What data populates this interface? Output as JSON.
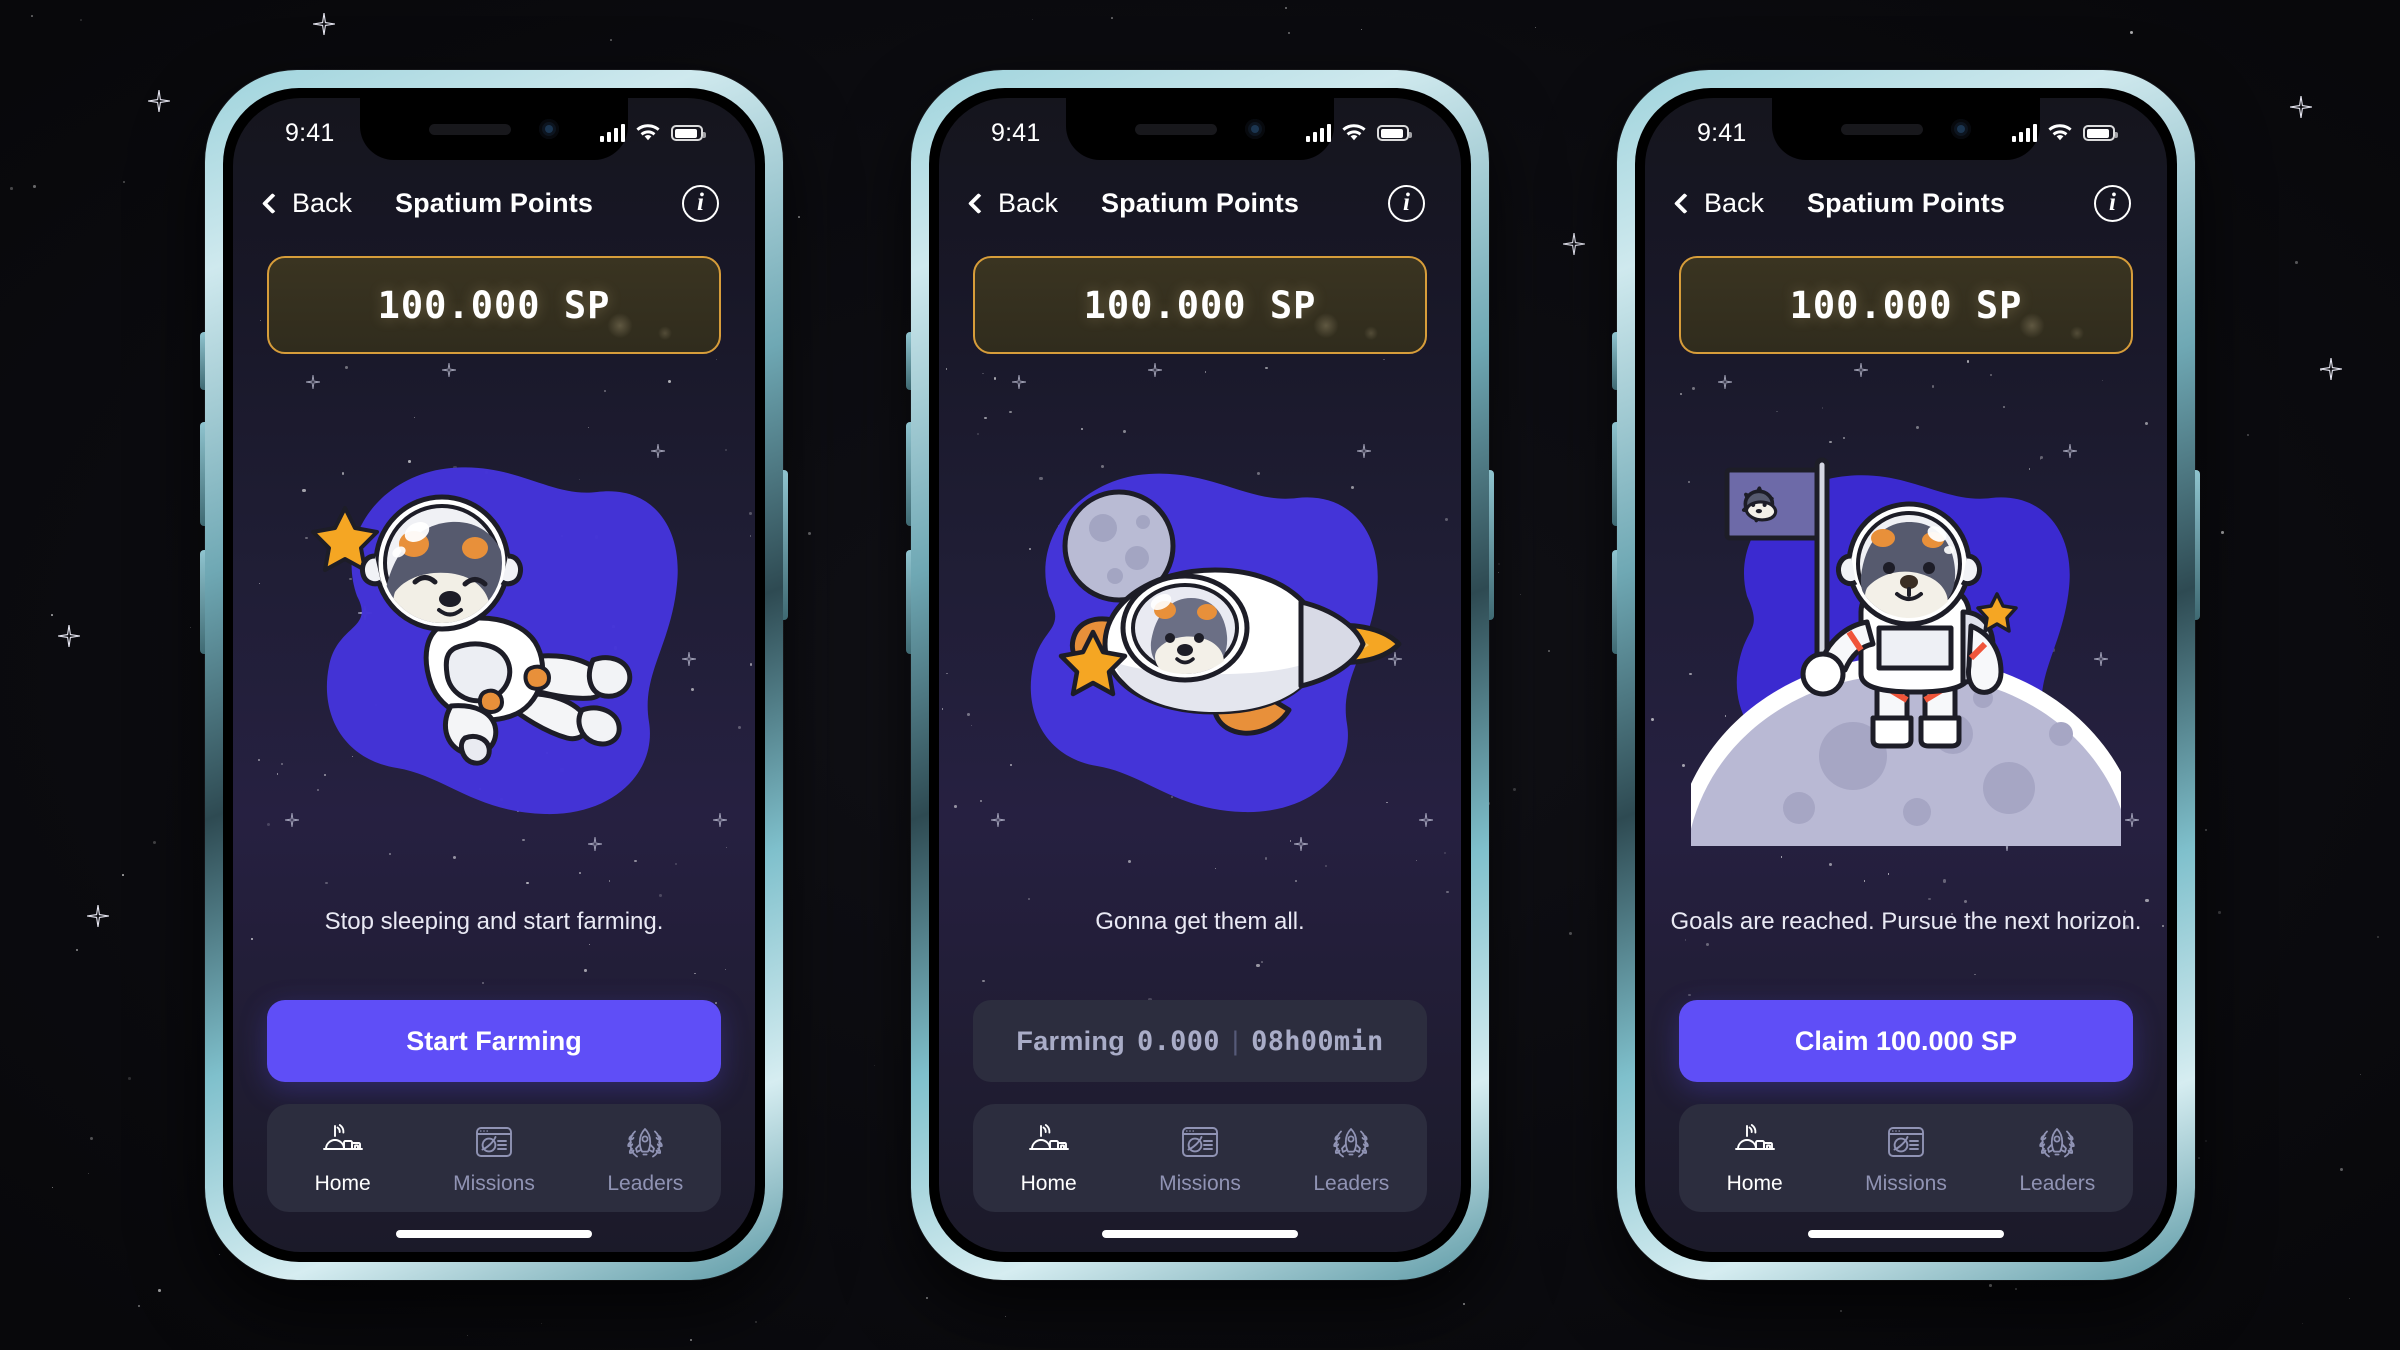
{
  "scene": {
    "background_color": "#0c0c10",
    "accent_purple": "#5f4ef7",
    "gold_border": "#d79d3a",
    "panel_color": "#2c2d3e"
  },
  "status_bar": {
    "time": "9:41",
    "signal_icon": "cellular-signal-icon",
    "wifi_icon": "wifi-icon",
    "battery_icon": "battery-icon"
  },
  "nav": {
    "back_label": "Back",
    "title": "Spatium Points",
    "info_label": "i",
    "back_icon": "chevron-left-icon",
    "info_icon": "info-circle-icon"
  },
  "balance": {
    "amount": "100.000",
    "currency": "SP",
    "display": "100.000 SP"
  },
  "tabs": [
    {
      "label": "Home",
      "icon": "space-station-icon",
      "active": true
    },
    {
      "label": "Missions",
      "icon": "planet-card-icon",
      "active": false
    },
    {
      "label": "Leaders",
      "icon": "rocket-laurel-icon",
      "active": false
    }
  ],
  "screens": [
    {
      "id": "idle",
      "illustration": "sleeping-astronaut-dog",
      "caption": "Stop sleeping and start farming.",
      "cta": {
        "label": "Start Farming",
        "style": "primary",
        "enabled": true
      }
    },
    {
      "id": "farming",
      "illustration": "astronaut-dog-in-rocket",
      "caption": "Gonna get them all.",
      "cta": {
        "style": "ghost",
        "enabled": false,
        "label_prefix": "Farming",
        "amount": "0.000",
        "separator": "|",
        "timer": "08h00min"
      }
    },
    {
      "id": "claim",
      "illustration": "astronaut-dog-flag-on-moon",
      "caption": "Goals are reached. Pursue the next horizon.",
      "cta": {
        "label": "Claim 100.000 SP",
        "style": "primary",
        "enabled": true
      }
    }
  ]
}
